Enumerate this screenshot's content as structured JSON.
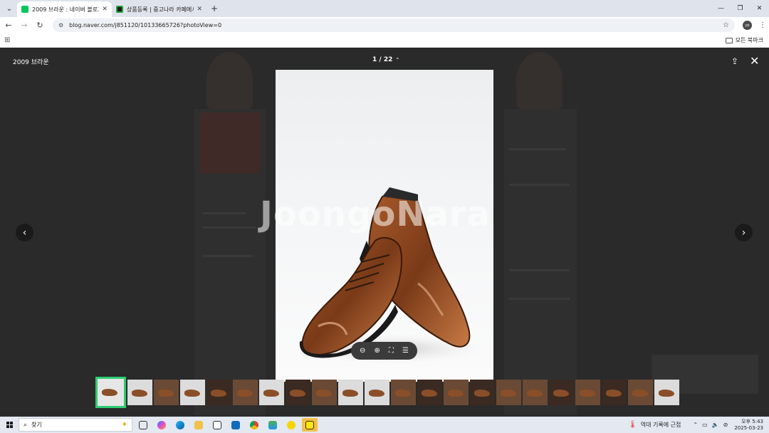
{
  "browser": {
    "tabs": [
      {
        "title": "2009 브라운 : 네이버 블로그",
        "favicon_color": "#03c75a",
        "active": true
      },
      {
        "title": "상품등록 | 중고나라 카페에서",
        "favicon_color": "#2a9d3a",
        "active": false
      }
    ],
    "url": "blog.naver.com/j851120/10133665726?photoView=0",
    "profile_label": "yb",
    "bookmarks_label": "모든 북마크"
  },
  "viewer": {
    "title": "2009 브라운",
    "counter": "1 / 22",
    "watermark": "JoongoNara",
    "thumbnail_count": 22
  },
  "taskbar": {
    "search_label": "찾기",
    "weather_text": "역대 기록에 근접",
    "time": "오후 5:43",
    "date": "2025-03-23"
  }
}
